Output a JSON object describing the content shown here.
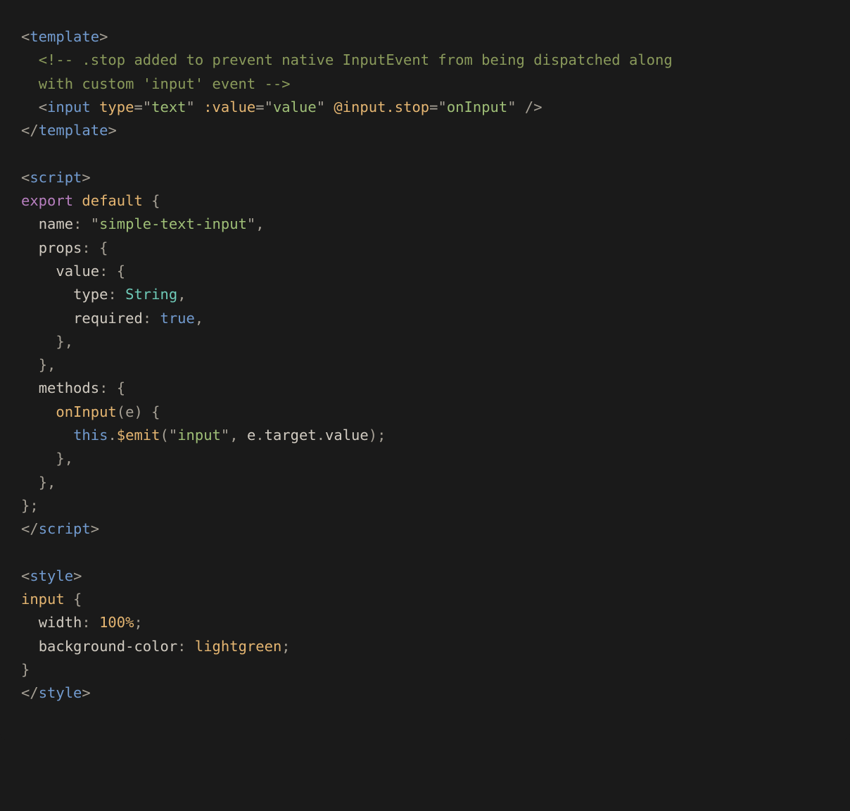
{
  "code": {
    "l1": {
      "p1": "<",
      "tag": "template",
      "p2": ">"
    },
    "l2": {
      "indent": "  ",
      "open": "<!-- ",
      "text": ".stop added to prevent native InputEvent from being dispatched along"
    },
    "l3": {
      "indent": "  ",
      "text": "with custom 'input' event",
      "close": " -->"
    },
    "l4": {
      "indent": "  ",
      "p1": "<",
      "tag": "input",
      "sp": " ",
      "a1": "type",
      "eq1": "=",
      "q1": "\"",
      "v1": "text",
      "q1b": "\"",
      "sp2": " ",
      "a2": ":value",
      "eq2": "=",
      "q2": "\"",
      "v2": "value",
      "q2b": "\"",
      "sp3": " ",
      "a3": "@input.stop",
      "eq3": "=",
      "q3": "\"",
      "v3": "onInput",
      "q3b": "\"",
      "close": " />"
    },
    "l5": {
      "p1": "</",
      "tag": "template",
      "p2": ">"
    },
    "l6": "",
    "l7": {
      "p1": "<",
      "tag": "script",
      "p2": ">"
    },
    "l8": {
      "kw1": "export",
      "sp": " ",
      "kw2": "default",
      "rest": " {"
    },
    "l9": {
      "indent": "  ",
      "prop": "name",
      "colon": ": ",
      "q1": "\"",
      "str": "simple-text-input",
      "q2": "\"",
      "comma": ","
    },
    "l10": {
      "indent": "  ",
      "prop": "props",
      "rest": ": {"
    },
    "l11": {
      "indent": "    ",
      "prop": "value",
      "rest": ": {"
    },
    "l12": {
      "indent": "      ",
      "prop": "type",
      "colon": ": ",
      "val": "String",
      "comma": ","
    },
    "l13": {
      "indent": "      ",
      "prop": "required",
      "colon": ": ",
      "val": "true",
      "comma": ","
    },
    "l14": {
      "indent": "    ",
      "text": "},"
    },
    "l15": {
      "indent": "  ",
      "text": "},"
    },
    "l16": {
      "indent": "  ",
      "prop": "methods",
      "rest": ": {"
    },
    "l17": {
      "indent": "    ",
      "fn": "onInput",
      "args": "(e) {"
    },
    "l18": {
      "indent": "      ",
      "this": "this",
      "dot1": ".",
      "emit": "$emit",
      "open": "(",
      "q1": "\"",
      "str": "input",
      "q2": "\"",
      "comma": ", ",
      "e": "e",
      "dot2": ".",
      "target": "target",
      "dot3": ".",
      "value": "value",
      "close": ");"
    },
    "l19": {
      "indent": "    ",
      "text": "},"
    },
    "l20": {
      "indent": "  ",
      "text": "},"
    },
    "l21": {
      "text": "};"
    },
    "l22": {
      "p1": "</",
      "tag": "script",
      "p2": ">"
    },
    "l23": "",
    "l24": {
      "p1": "<",
      "tag": "style",
      "p2": ">"
    },
    "l25": {
      "sel": "input",
      "brace": " {"
    },
    "l26": {
      "indent": "  ",
      "prop": "width",
      "colon": ": ",
      "val": "100%",
      "semi": ";"
    },
    "l27": {
      "indent": "  ",
      "prop": "background-color",
      "colon": ": ",
      "val": "lightgreen",
      "semi": ";"
    },
    "l28": {
      "text": "}"
    },
    "l29": {
      "p1": "</",
      "tag": "style",
      "p2": ">"
    }
  }
}
